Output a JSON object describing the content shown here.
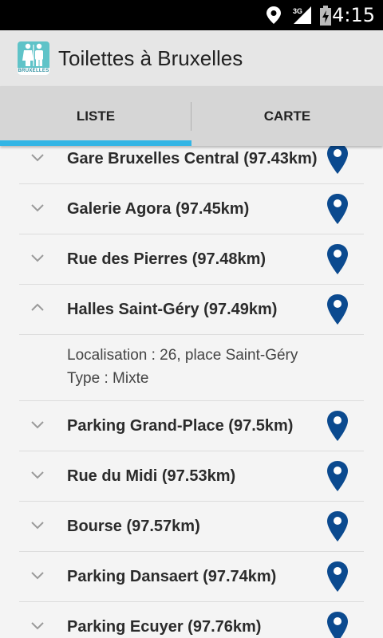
{
  "status_bar": {
    "time": "4:15",
    "network": "3G",
    "icons": [
      "location-icon",
      "signal-icon",
      "battery-icon"
    ]
  },
  "app": {
    "title": "Toilettes à Bruxelles",
    "logo_text": "BRUXELLES"
  },
  "tabs": [
    {
      "label": "LISTE",
      "selected": true
    },
    {
      "label": "CARTE",
      "selected": false
    }
  ],
  "colors": {
    "accent": "#33b5e5",
    "pin": "#0b4a8f",
    "logo": "#5fc3c8"
  },
  "list": {
    "items": [
      {
        "label": "Gare Bruxelles Central (97.43km)",
        "expanded": false
      },
      {
        "label": "Galerie Agora (97.45km)",
        "expanded": false
      },
      {
        "label": "Rue des Pierres (97.48km)",
        "expanded": false
      },
      {
        "label": "Halles Saint-Géry (97.49km)",
        "expanded": true,
        "details": [
          "Localisation : 26, place Saint-Géry",
          "Type : Mixte"
        ]
      },
      {
        "label": "Parking Grand-Place (97.5km)",
        "expanded": false
      },
      {
        "label": "Rue du Midi (97.53km)",
        "expanded": false
      },
      {
        "label": "Bourse (97.57km)",
        "expanded": false
      },
      {
        "label": "Parking Dansaert (97.74km)",
        "expanded": false
      },
      {
        "label": "Parking Ecuyer (97.76km)",
        "expanded": false
      }
    ]
  }
}
